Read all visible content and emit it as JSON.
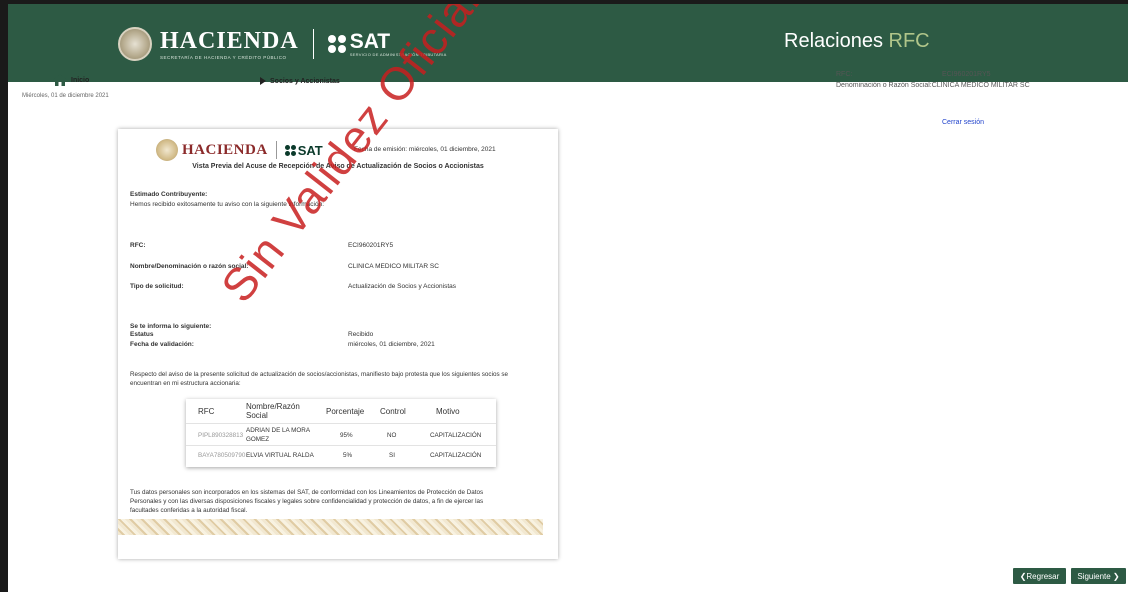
{
  "header": {
    "hacienda_logo_text": "HACIENDA",
    "hacienda_logo_sub": "SECRETARÍA DE HACIENDA Y CRÉDITO PÚBLICO",
    "sat_logo_text": "SAT",
    "sat_logo_sub": "SERVICIO DE ADMINISTRACIÓN TRIBUTARIA",
    "title_main": "Relaciones",
    "title_accent": "RFC",
    "bar_color": "#2d5a44"
  },
  "nav": {
    "home_label": "Inicio",
    "date": "Miércoles, 01 de diciembre 2021",
    "breadcrumb": "Socios y Accionistas"
  },
  "taxpayer": {
    "rfc_label": "RFC:",
    "rfc_value": "ECI960201RY5",
    "name_label": "Denominación o Razón Social:",
    "name_value": "CLINICA MEDICO MILITAR SC",
    "logout": "Cerrar sesión"
  },
  "document": {
    "logo_hacienda": "HACIENDA",
    "logo_sat": "SAT",
    "emission_date": "Fecha de emisión: miércoles, 01 diciembre, 2021",
    "title": "Vista Previa del Acuse de Recepción de Aviso de Actualización de Socios o Accionistas",
    "greeting": "Estimado Contribuyente:",
    "intro": "Hemos recibido exitosamente tu aviso con la siguiente información:",
    "fields": {
      "rfc_label": "RFC:",
      "rfc_value": "ECI960201RY5",
      "name_label": "Nombre/Denominación o razón social:",
      "name_value": "CLINICA MEDICO MILITAR SC",
      "type_label": "Tipo de solicitud:",
      "type_value": "Actualización de Socios y Accionistas"
    },
    "inform_heading": "Se te informa lo siguiente:",
    "status_label": "Estatus",
    "status_value": "Recibido",
    "validation_label": "Fecha de validación:",
    "validation_value": "miércoles, 01 diciembre, 2021",
    "protest_line1": "Respecto del aviso de la presente solicitud de actualización de socios/accionistas, manifiesto bajo protesta que los siguientes socios se",
    "protest_line2": "encuentran en mi estructura accionaria:",
    "table": {
      "headers": [
        "RFC",
        "Nombre/Razón Social",
        "Porcentaje",
        "Control",
        "Motivo"
      ],
      "rows": [
        {
          "rfc": "PIPL890328813",
          "name": "ADRIAN DE LA MORA GOMEZ",
          "pct": "95%",
          "control": "NO",
          "motivo": "CAPITALIZACIÓN"
        },
        {
          "rfc": "BAYA780509790",
          "name": "ELVIA VIRTUAL RALDA",
          "pct": "5%",
          "control": "SI",
          "motivo": "CAPITALIZACIÓN"
        }
      ]
    },
    "privacy_line1": "Tus datos personales son incorporados en los sistemas del SAT, de conformidad con los Lineamientos de Protección de Datos",
    "privacy_line2": "Personales y con las diversas disposiciones fiscales y legales sobre confidencialidad y protección de datos, a fin de ejercer las",
    "privacy_line3": "facultades conferidas a la autoridad fiscal.",
    "watermark": "Sin Validez Oficial"
  },
  "actions": {
    "back": "Regresar",
    "next": "Siguiente"
  }
}
